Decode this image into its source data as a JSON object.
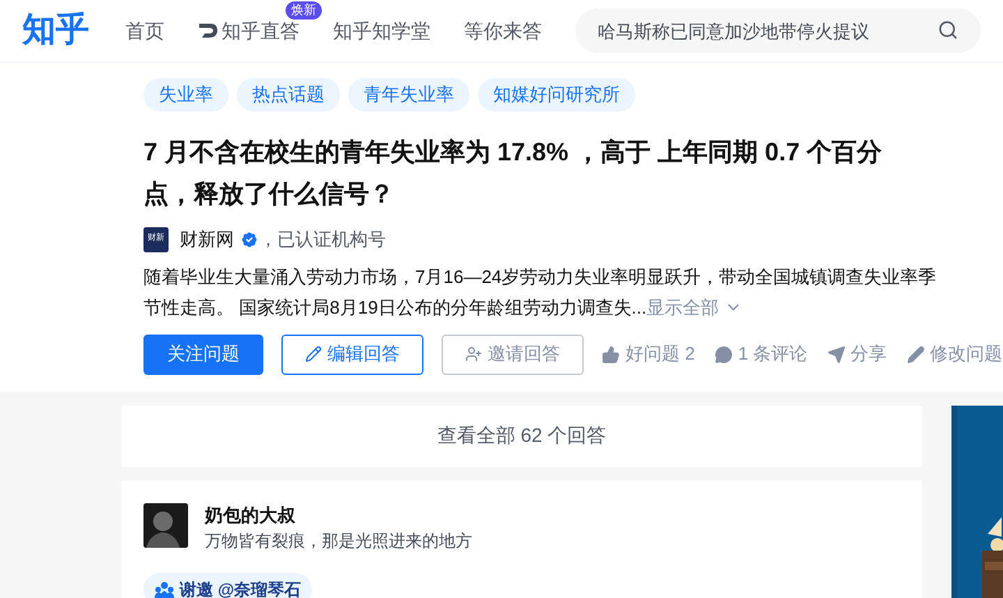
{
  "header": {
    "logo": "知乎",
    "nav": [
      {
        "label": "首页",
        "kind": "plain"
      },
      {
        "label": "知乎直答",
        "kind": "zhida",
        "badge": "焕新"
      },
      {
        "label": "知乎知学堂",
        "kind": "plain"
      },
      {
        "label": "等你来答",
        "kind": "plain"
      }
    ],
    "search": {
      "placeholder": "哈马斯称已同意加沙地带停火提议"
    }
  },
  "question": {
    "topics": [
      "失业率",
      "热点话题",
      "青年失业率",
      "知媒好问研究所"
    ],
    "title": "7 月不含在校生的青年失业率为 17.8% ，高于 上年同期 0.7 个百分点，释放了什么信号？",
    "author": {
      "logo": "财新",
      "name": "财新网",
      "verified": true,
      "note": "，已认证机构号"
    },
    "excerpt_lines": [
      "随着毕业生大量涌入劳动力市场，7月16—24岁劳动力失业率明显跃升，带动全国城镇调查失业率季",
      "节性走高。 国家统计局8月19日公布的分年龄组劳动力调查失..."
    ],
    "show_all": "显示全部",
    "actions": [
      {
        "label": "关注问题",
        "kind": "primary"
      },
      {
        "label": "编辑回答",
        "kind": "outline"
      },
      {
        "label": "邀请回答",
        "kind": "gray"
      }
    ],
    "meta": [
      {
        "label": "好问题 2",
        "kind": "like"
      },
      {
        "label": "1 条评论",
        "kind": "comment"
      },
      {
        "label": "分享",
        "kind": "share"
      },
      {
        "label": "修改问题",
        "kind": "edit"
      }
    ]
  },
  "view_all": "查看全部 62 个回答",
  "answer": {
    "name": "奶包的大叔",
    "bio": "万物皆有裂痕，那是光照进来的地方",
    "thanks": "谢邀 @奈瑠琴石"
  }
}
